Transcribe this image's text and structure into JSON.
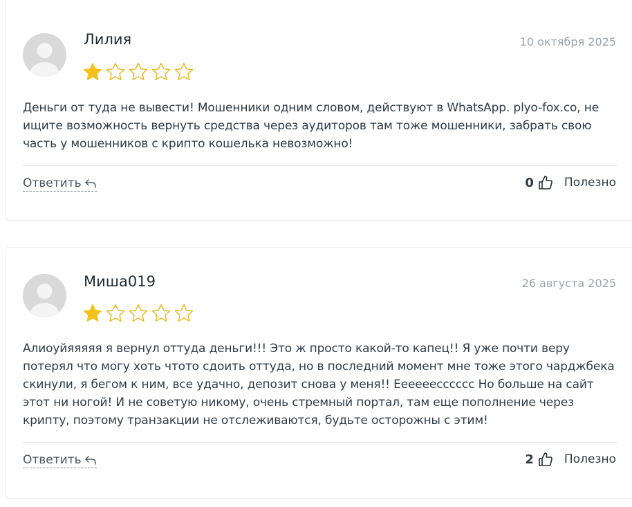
{
  "reviews": [
    {
      "author": "Лилия",
      "date": "10 октября 2025",
      "rating": 1,
      "max_rating": 5,
      "text": "Деньги от туда не вывести! Мошенники одним словом, действуют в WhatsApp. plyo-fox.co, не ищите возможность вернуть средства через аудиторов там тоже мошенники, забрать свою часть у мошенников с крипто кошелька невозможно!",
      "reply_label": "Ответить",
      "helpful_count": "0",
      "helpful_label": "Полезно"
    },
    {
      "author": "Миша019",
      "date": "26 августа 2025",
      "rating": 1,
      "max_rating": 5,
      "text": "Алиоуйяяяяя я вернул оттуда деньги!!! Это ж просто какой-то капец!! Я уже почти веру потерял что могу хоть чтото сдоить оттуда, но в последний момент мне тоже этого чарджбека скинули, я бегом к ним, все удачно, депозит снова у меня!! Еееееесссссс Но больше на сайт этот ни ногой! И не советую никому, очень стремный портал, там еще пополнение через крипту, поэтому транзакции не отслеживаются, будьте осторожны с этим!",
      "reply_label": "Ответить",
      "helpful_count": "2",
      "helpful_label": "Полезно"
    }
  ],
  "colors": {
    "star_filled": "#f2c21b",
    "star_outline": "#e8b923",
    "avatar_bg": "#d9d9d9",
    "avatar_fg": "#f4f4f4",
    "date": "#9aa3ab",
    "divider": "#e6e9ec"
  },
  "icons": {
    "avatar": "user-silhouette-icon",
    "star": "star-icon",
    "reply": "reply-arrow-icon",
    "helpful": "thumbs-up-icon"
  }
}
